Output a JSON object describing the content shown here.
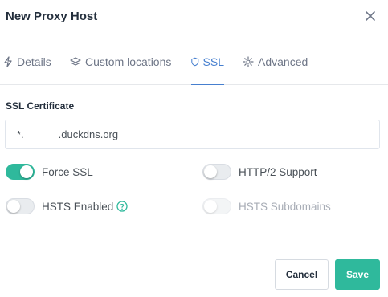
{
  "modal": {
    "title": "New Proxy Host"
  },
  "tabs": [
    {
      "label": "Details",
      "icon": "lightning-icon",
      "active": false
    },
    {
      "label": "Custom locations",
      "icon": "layers-icon",
      "active": false
    },
    {
      "label": "SSL",
      "icon": "shield-icon",
      "active": true
    },
    {
      "label": "Advanced",
      "icon": "gear-icon",
      "active": false
    }
  ],
  "ssl": {
    "certificate_label": "SSL Certificate",
    "certificate_value_prefix": "*.",
    "certificate_value_suffix": ".duckdns.org"
  },
  "options": {
    "force_ssl": {
      "label": "Force SSL",
      "enabled": true
    },
    "http2": {
      "label": "HTTP/2 Support",
      "enabled": false
    },
    "hsts": {
      "label": "HSTS Enabled",
      "enabled": false
    },
    "hsts_subdomains": {
      "label": "HSTS Subdomains",
      "enabled": false,
      "disabled": true
    }
  },
  "footer": {
    "cancel_label": "Cancel",
    "save_label": "Save"
  },
  "colors": {
    "accent": "#2fb99c",
    "tab_active": "#467fcf"
  }
}
